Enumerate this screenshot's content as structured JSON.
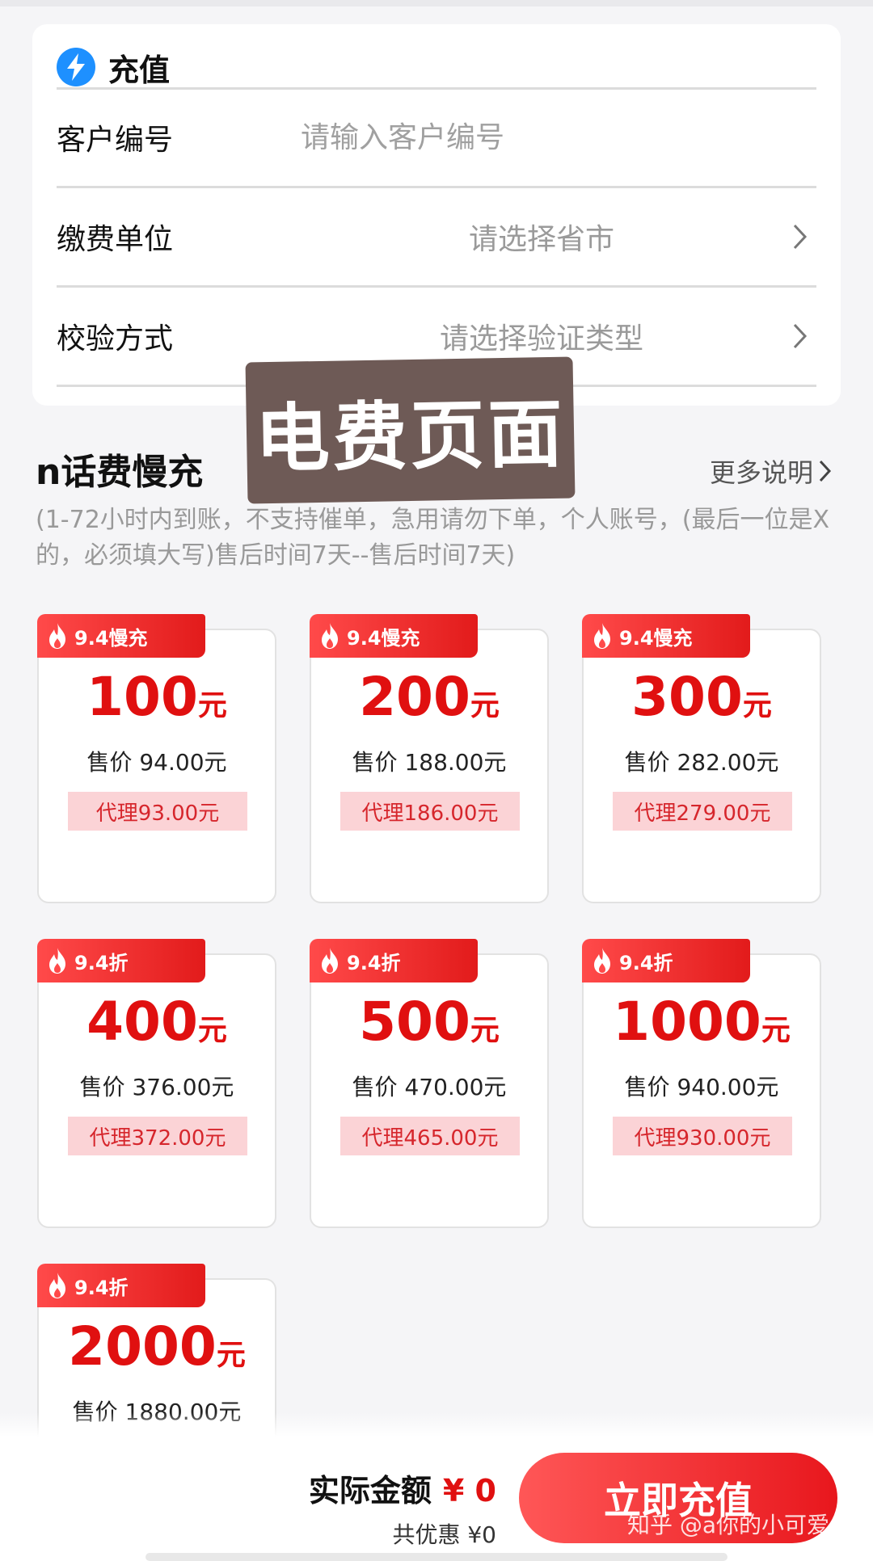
{
  "form": {
    "title": "充值",
    "rows": [
      {
        "label": "客户编号",
        "placeholder": "请输入客户编号"
      },
      {
        "label": "缴费单位",
        "value": "请选择省市"
      },
      {
        "label": "校验方式",
        "value": "请选择验证类型"
      }
    ]
  },
  "sticker": "电费页面",
  "section": {
    "title": "n话费慢充",
    "more_link": "更多说明",
    "description": "(1-72小时内到账，不支持催单，急用请勿下单，个人账号，(最后一位是X的，必须填大写)售后时间7天--售后时间7天)"
  },
  "products": [
    {
      "tag": "9.4慢充",
      "amount": "100",
      "unit": "元",
      "price": "售价 94.00元",
      "agent": "代理93.00元"
    },
    {
      "tag": "9.4慢充",
      "amount": "200",
      "unit": "元",
      "price": "售价 188.00元",
      "agent": "代理186.00元"
    },
    {
      "tag": "9.4慢充",
      "amount": "300",
      "unit": "元",
      "price": "售价 282.00元",
      "agent": "代理279.00元"
    },
    {
      "tag": "9.4折",
      "amount": "400",
      "unit": "元",
      "price": "售价 376.00元",
      "agent": "代理372.00元"
    },
    {
      "tag": "9.4折",
      "amount": "500",
      "unit": "元",
      "price": "售价 470.00元",
      "agent": "代理465.00元"
    },
    {
      "tag": "9.4折",
      "amount": "1000",
      "unit": "元",
      "price": "售价 940.00元",
      "agent": "代理930.00元"
    },
    {
      "tag": "9.4折",
      "amount": "2000",
      "unit": "元",
      "price": "售价 1880.00元",
      "agent": ""
    }
  ],
  "bottom": {
    "total_label": "实际金额",
    "total_value": "¥ 0",
    "discount": "共优惠 ¥0",
    "pay_button": "立即充值"
  },
  "watermark": "知乎 @a你的小可爱",
  "colors": {
    "accent": "#e01010",
    "agent_bg": "#fbd3d6",
    "bolt_icon": "#1e90ff"
  }
}
